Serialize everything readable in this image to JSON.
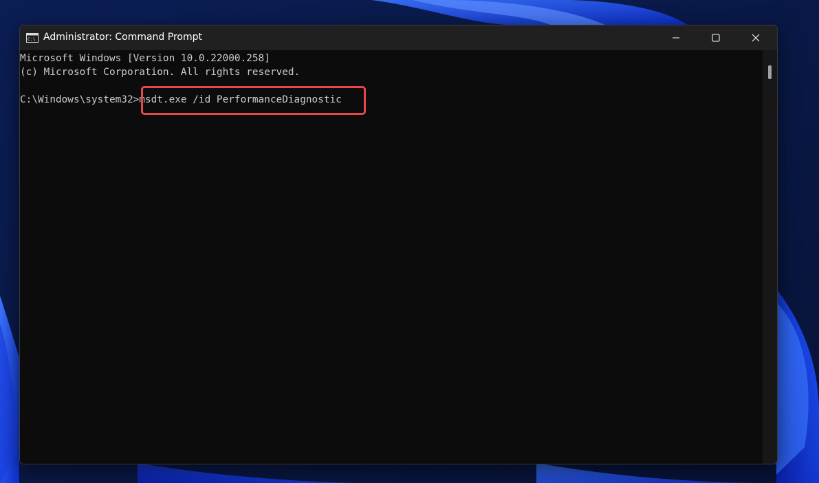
{
  "window": {
    "title": "Administrator: Command Prompt",
    "icon": "cmd-icon"
  },
  "caption_buttons": {
    "minimize": "minimize-icon",
    "maximize": "maximize-icon",
    "close": "close-icon"
  },
  "console": {
    "lines": [
      "Microsoft Windows [Version 10.0.22000.258]",
      "(c) Microsoft Corporation. All rights reserved.",
      "",
      "C:\\Windows\\system32>msdt.exe /id PerformanceDiagnostic"
    ],
    "highlighted_command": "msdt.exe /id PerformanceDiagnostic"
  },
  "colors": {
    "console_background": "#0c0c0c",
    "console_text": "#cccccc",
    "titlebar": "#202020",
    "highlight": "#e8474a",
    "desktop_accent": "#1e4fff"
  }
}
